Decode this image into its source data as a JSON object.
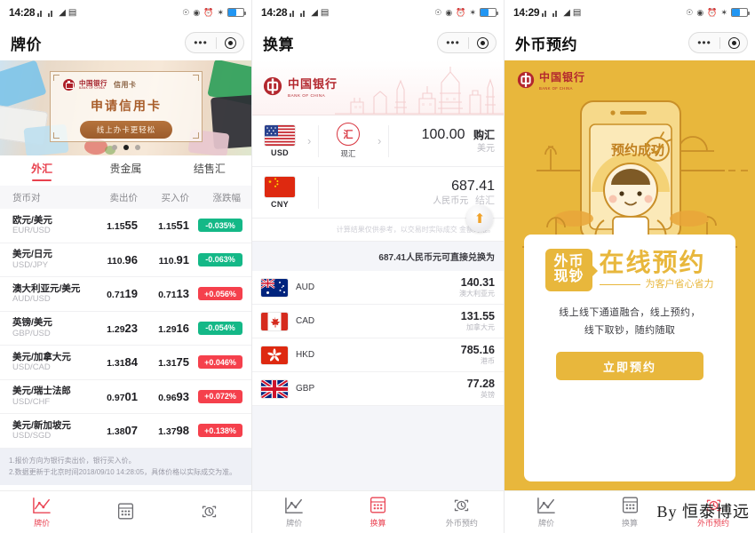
{
  "panel1": {
    "status": {
      "time": "14:28"
    },
    "nav": {
      "title": "牌价",
      "dots": "•••",
      "target_icon": "target-icon"
    },
    "banner": {
      "brand_cn": "中国银行",
      "brand_en": "BANK OF CHINA",
      "tag": "信用卡",
      "title": "申请信用卡",
      "button": "线上办卡更轻松",
      "active_dot": 1,
      "dot_count": 3
    },
    "tabs": [
      {
        "label": "外汇",
        "active": true
      },
      {
        "label": "贵金属",
        "active": false
      },
      {
        "label": "结售汇",
        "active": false
      }
    ],
    "table": {
      "headers": [
        "货币对",
        "卖出价",
        "买入价",
        "涨跌幅"
      ],
      "rows": [
        {
          "cn": "欧元/美元",
          "en": "EUR/USD",
          "sell_head": "1.15",
          "sell_tail": "55",
          "buy_head": "1.15",
          "buy_tail": "51",
          "change": "-0.035%",
          "up": false
        },
        {
          "cn": "美元/日元",
          "en": "USD/JPY",
          "sell_head": "110.",
          "sell_tail": "96",
          "buy_head": "110.",
          "buy_tail": "91",
          "change": "-0.063%",
          "up": false
        },
        {
          "cn": "澳大利亚元/美元",
          "en": "AUD/USD",
          "sell_head": "0.71",
          "sell_tail": "19",
          "buy_head": "0.71",
          "buy_tail": "13",
          "change": "+0.056%",
          "up": true
        },
        {
          "cn": "英镑/美元",
          "en": "GBP/USD",
          "sell_head": "1.29",
          "sell_tail": "23",
          "buy_head": "1.29",
          "buy_tail": "16",
          "change": "-0.054%",
          "up": false
        },
        {
          "cn": "美元/加拿大元",
          "en": "USD/CAD",
          "sell_head": "1.31",
          "sell_tail": "84",
          "buy_head": "1.31",
          "buy_tail": "75",
          "change": "+0.046%",
          "up": true
        },
        {
          "cn": "美元/瑞士法郎",
          "en": "USD/CHF",
          "sell_head": "0.97",
          "sell_tail": "01",
          "buy_head": "0.96",
          "buy_tail": "93",
          "change": "+0.072%",
          "up": true
        },
        {
          "cn": "美元/新加坡元",
          "en": "USD/SGD",
          "sell_head": "1.38",
          "sell_tail": "07",
          "buy_head": "1.37",
          "buy_tail": "98",
          "change": "+0.138%",
          "up": true
        }
      ]
    },
    "notes": [
      "1.报价方向为银行卖出价，银行买入价。",
      "2.数据更新于北京时间2018/09/10 14:28:05，具体价格以实际成交为准。"
    ],
    "tabbar": [
      {
        "label": "牌价",
        "icon": "chart-icon",
        "active": true
      },
      {
        "label": "",
        "icon": "calculator-icon",
        "active": false
      },
      {
        "label": "",
        "icon": "alarm-clock-icon",
        "active": false
      }
    ]
  },
  "panel2": {
    "status": {
      "time": "14:28"
    },
    "nav": {
      "title": "换算",
      "dots": "•••",
      "target_icon": "target-icon"
    },
    "hero": {
      "brand_cn": "中国银行",
      "brand_en": "BANK OF CHINA"
    },
    "converter": {
      "from": {
        "code": "USD",
        "flag": "us-flag",
        "mode_glyph": "汇",
        "mode_label": "现汇",
        "amount": "100.00",
        "action": "购汇",
        "currency_name": "美元"
      },
      "to": {
        "code": "CNY",
        "flag": "cn-flag",
        "amount": "687.41",
        "action": "结汇",
        "currency_name": "人民币元"
      },
      "swap_icon": "swap-arrow-icon",
      "hint": "计算结果仅供参考，以交易时实际成交 金额为准。",
      "exchange_line": "687.41人民币元可直接兑换为"
    },
    "currency_list": [
      {
        "code": "AUD",
        "flag": "au-flag",
        "amount": "140.31",
        "name": "澳大利亚元"
      },
      {
        "code": "CAD",
        "flag": "ca-flag",
        "amount": "131.55",
        "name": "加拿大元"
      },
      {
        "code": "HKD",
        "flag": "hk-flag",
        "amount": "785.16",
        "name": "港币"
      },
      {
        "code": "GBP",
        "flag": "gb-flag",
        "amount": "77.28",
        "name": "英镑"
      }
    ],
    "tabbar": [
      {
        "label": "牌价",
        "icon": "chart-icon",
        "active": false
      },
      {
        "label": "换算",
        "icon": "calculator-icon",
        "active": true
      },
      {
        "label": "外币预约",
        "icon": "alarm-clock-icon",
        "active": false
      }
    ]
  },
  "panel3": {
    "status": {
      "time": "14:29"
    },
    "nav": {
      "title": "外币预约",
      "dots": "•••",
      "target_icon": "target-icon"
    },
    "promo": {
      "brand_cn": "中国银行",
      "brand_en": "BANK OF CHINA",
      "phone_badge": "预约成功",
      "tag_line1": "外币",
      "tag_line2": "现钞",
      "headline": "在线预约",
      "subhead": "为客户省心省力",
      "desc_line1": "线上线下通道融合，线上预约，",
      "desc_line2": "线下取钞，随约随取",
      "cta": "立即预约"
    },
    "tabbar": [
      {
        "label": "牌价",
        "icon": "chart-icon",
        "active": false
      },
      {
        "label": "换算",
        "icon": "calculator-icon",
        "active": false
      },
      {
        "label": "外币预约",
        "icon": "alarm-clock-icon",
        "active": true
      }
    ],
    "watermark": "By 恒泰博远"
  },
  "colors": {
    "accent_red": "#ea4554",
    "up_red": "#f5404c",
    "down_green": "#14b887",
    "promo_yellow": "#e8b73c",
    "boc_red": "#b3272e"
  }
}
